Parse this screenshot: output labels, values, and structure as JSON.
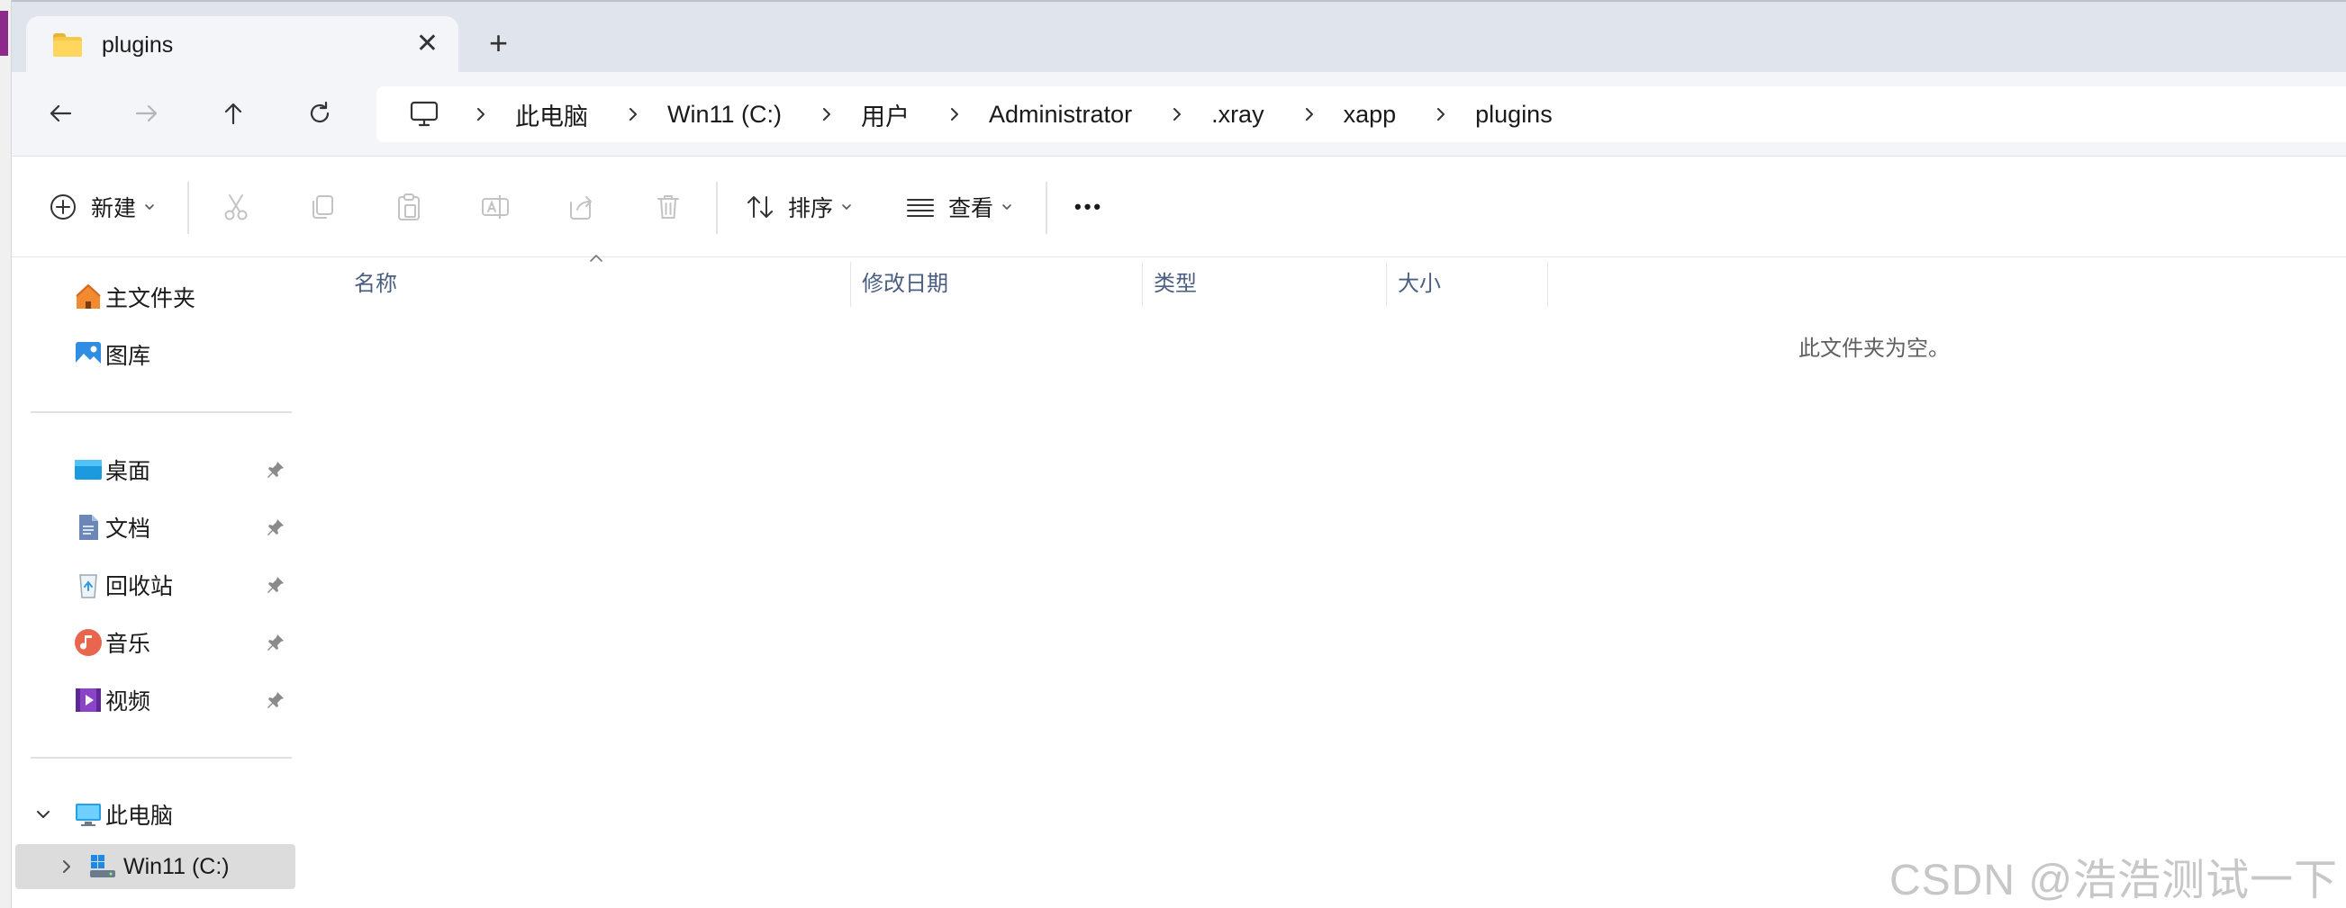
{
  "tab": {
    "title": "plugins",
    "close_glyph": "✕",
    "new_tab_glyph": "+"
  },
  "breadcrumb": [
    "此电脑",
    "Win11 (C:)",
    "用户",
    "Administrator",
    ".xray",
    "xapp",
    "plugins"
  ],
  "toolbar": {
    "new_label": "新建",
    "sort_label": "排序",
    "view_label": "查看",
    "more_glyph": "•••"
  },
  "sidebar": {
    "quick": [
      {
        "label": "主文件夹",
        "icon": "home-icon"
      },
      {
        "label": "图库",
        "icon": "gallery-icon"
      }
    ],
    "pinned": [
      {
        "label": "桌面",
        "icon": "desktop-icon"
      },
      {
        "label": "文档",
        "icon": "documents-icon"
      },
      {
        "label": "回收站",
        "icon": "recycle-bin-icon"
      },
      {
        "label": "音乐",
        "icon": "music-icon"
      },
      {
        "label": "视频",
        "icon": "videos-icon"
      }
    ],
    "this_pc": {
      "label": "此电脑",
      "icon": "pc-icon"
    },
    "drive": {
      "label": "Win11 (C:)",
      "icon": "drive-icon"
    }
  },
  "columns": [
    "名称",
    "修改日期",
    "类型",
    "大小"
  ],
  "empty_message": "此文件夹为空。",
  "watermark": "CSDN @浩浩测试一下",
  "colors": {
    "accent": "#0067c0",
    "folder": "#ffd75e",
    "column_header": "#4a5f82",
    "selected_bg": "#dcdcdc"
  }
}
